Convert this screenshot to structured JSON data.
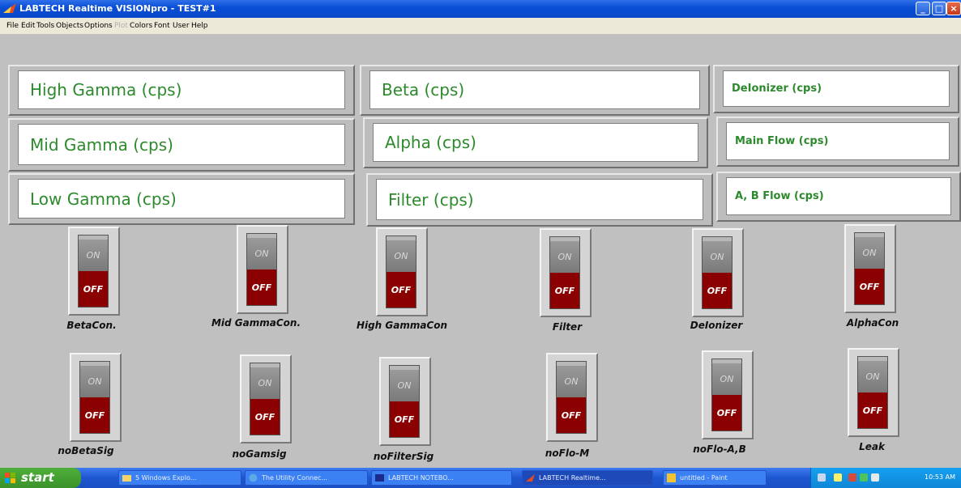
{
  "window": {
    "title": "LABTECH Realtime VISIONpro - TEST#1"
  },
  "menu": [
    {
      "label": "File",
      "disabled": false
    },
    {
      "label": "Edit",
      "disabled": false
    },
    {
      "label": "Tools",
      "disabled": false
    },
    {
      "label": "Objects",
      "disabled": false
    },
    {
      "label": "Options",
      "disabled": false
    },
    {
      "label": "Plot",
      "disabled": true
    },
    {
      "label": "Colors",
      "disabled": false
    },
    {
      "label": "Font",
      "disabled": false
    },
    {
      "label": "User",
      "disabled": false
    },
    {
      "label": "Help",
      "disabled": false
    }
  ],
  "displays": {
    "high_gamma": "High Gamma (cps)",
    "beta": "Beta (cps)",
    "deionizer": "DeIonizer (cps)",
    "mid_gamma": "Mid Gamma (cps)",
    "alpha": "Alpha (cps)",
    "main_flow": "Main Flow (cps)",
    "low_gamma": "Low Gamma (cps)",
    "filter": "Filter (cps)",
    "ab_flow": "A, B Flow (cps)"
  },
  "switch_text": {
    "on": "ON",
    "off": "OFF"
  },
  "switches_row1": [
    {
      "label": "BetaCon.",
      "state": "OFF"
    },
    {
      "label": "Mid GammaCon.",
      "state": "OFF"
    },
    {
      "label": "High GammaCon",
      "state": "OFF"
    },
    {
      "label": "Filter",
      "state": "OFF"
    },
    {
      "label": "DeIonizer",
      "state": "OFF"
    },
    {
      "label": "AlphaCon",
      "state": "OFF"
    }
  ],
  "switches_row2": [
    {
      "label": "noBetaSig",
      "state": "OFF"
    },
    {
      "label": "noGamsig",
      "state": "OFF"
    },
    {
      "label": "noFilterSig",
      "state": "OFF"
    },
    {
      "label": "noFlo-M",
      "state": "OFF"
    },
    {
      "label": "noFlo-A,B",
      "state": "OFF"
    },
    {
      "label": "Leak",
      "state": "OFF"
    }
  ],
  "taskbar": {
    "start": "start",
    "items": [
      {
        "label": "5 Windows Explo...",
        "active": false
      },
      {
        "label": "The Utility Connec...",
        "active": false
      },
      {
        "label": "LABTECH NOTEBO...",
        "active": false
      },
      {
        "label": "LABTECH Realtime...",
        "active": true
      },
      {
        "label": "untitled - Paint",
        "active": false
      }
    ],
    "clock": "10:53 AM"
  },
  "colors": {
    "display_text": "#2c8a2c",
    "switch_off": "#8b0000",
    "switch_on": "#8a8a8a",
    "background": "#c0c0c0"
  }
}
